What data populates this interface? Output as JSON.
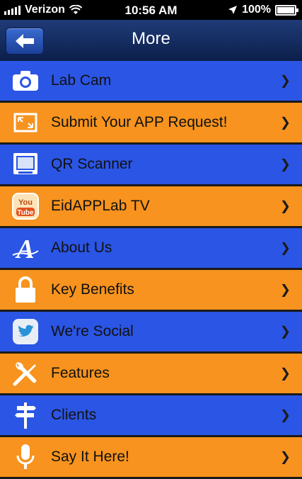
{
  "status_bar": {
    "carrier": "Verizon",
    "time": "10:56 AM",
    "battery": "100%"
  },
  "nav": {
    "title": "More",
    "back_icon": "back-arrow-icon"
  },
  "menu": [
    {
      "label": "Lab Cam",
      "color": "blue",
      "icon": "camera-icon"
    },
    {
      "label": "Submit Your APP Request!",
      "color": "orange",
      "icon": "expand-icon"
    },
    {
      "label": "QR Scanner",
      "color": "blue",
      "icon": "monitor-icon"
    },
    {
      "label": "EidAPPLab TV",
      "color": "orange",
      "icon": "youtube-icon",
      "icon_text": [
        "You",
        "Tube"
      ]
    },
    {
      "label": "About Us",
      "color": "blue",
      "icon": "letter-a-icon",
      "icon_text": [
        "A"
      ]
    },
    {
      "label": "Key Benefits",
      "color": "orange",
      "icon": "lock-icon"
    },
    {
      "label": "We're Social",
      "color": "blue",
      "icon": "twitter-bird-icon"
    },
    {
      "label": "Features",
      "color": "orange",
      "icon": "tools-icon"
    },
    {
      "label": "Clients",
      "color": "blue",
      "icon": "signpost-icon"
    },
    {
      "label": "Say It Here!",
      "color": "orange",
      "icon": "microphone-icon"
    }
  ],
  "colors": {
    "blue_row": "#2b55e4",
    "orange_row": "#f7931e",
    "nav_bar": "#1f3b78"
  }
}
